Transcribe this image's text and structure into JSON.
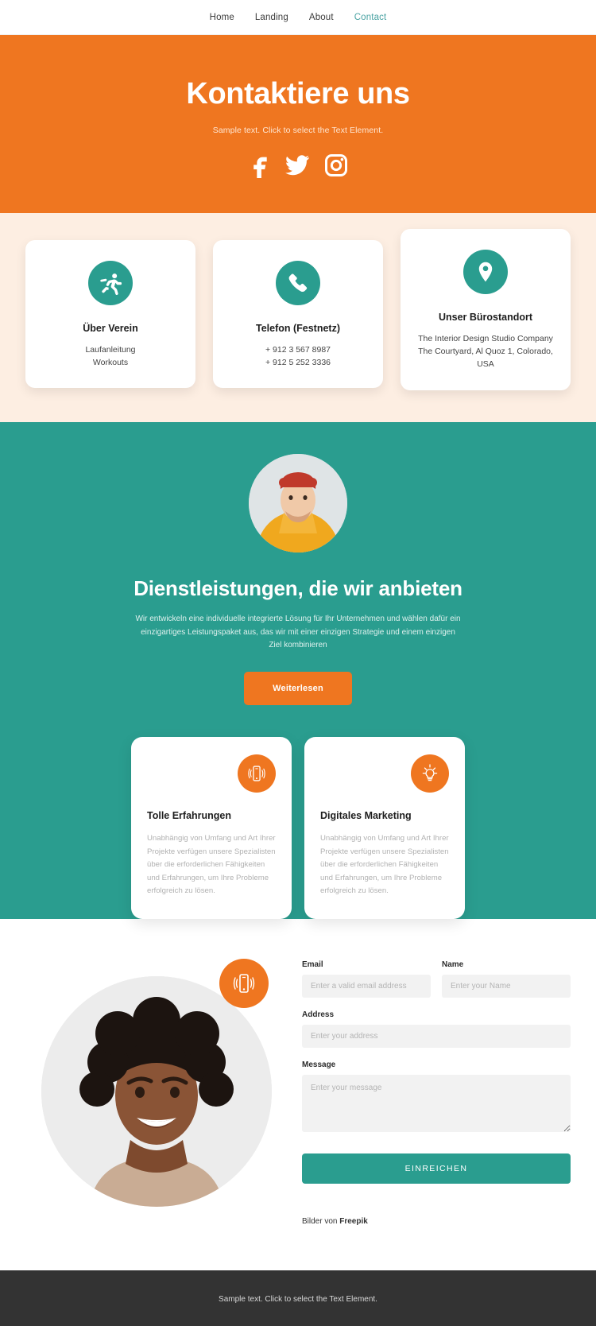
{
  "nav": {
    "items": [
      {
        "label": "Home",
        "active": false
      },
      {
        "label": "Landing",
        "active": false
      },
      {
        "label": "About",
        "active": false
      },
      {
        "label": "Contact",
        "active": true
      }
    ]
  },
  "hero": {
    "title": "Kontaktiere uns",
    "subtitle": "Sample text. Click to select the Text Element.",
    "background_color": "#ef7620",
    "socials": [
      {
        "name": "facebook-icon"
      },
      {
        "name": "twitter-icon"
      },
      {
        "name": "instagram-icon"
      }
    ]
  },
  "contact_cards": {
    "background_color": "#fdeee2",
    "icon_color": "#2a9d8f",
    "items": [
      {
        "icon": "running-person-icon",
        "title": "Über Verein",
        "lines": [
          "Laufanleitung",
          "Workouts"
        ]
      },
      {
        "icon": "phone-icon",
        "title": "Telefon (Festnetz)",
        "lines": [
          "+ 912 3 567 8987",
          "+ 912 5 252 3336"
        ]
      },
      {
        "icon": "map-pin-icon",
        "title": "Unser Bürostandort",
        "lines": [
          "The Interior Design Studio Company",
          "The Courtyard, Al Quoz 1, Colorado,",
          "USA"
        ]
      }
    ]
  },
  "services": {
    "background_color": "#2a9d8f",
    "avatar_alt": "man-with-red-beanie-photo",
    "title": "Dienstleistungen, die wir anbieten",
    "body": "Wir entwickeln eine individuelle integrierte Lösung für Ihr Unternehmen und wählen dafür ein einzigartiges Leistungspaket aus, das wir mit einer einzigen Strategie und einem einzigen Ziel kombinieren",
    "cta_label": "Weiterlesen",
    "cta_color": "#ef7620",
    "features": [
      {
        "icon": "vibrating-phone-icon",
        "title": "Tolle Erfahrungen",
        "body": "Unabhängig von Umfang und Art Ihrer Projekte verfügen unsere Spezialisten über die erforderlichen Fähigkeiten und Erfahrungen, um Ihre Probleme erfolgreich zu lösen."
      },
      {
        "icon": "lightbulb-icon",
        "title": "Digitales Marketing",
        "body": "Unabhängig von Umfang und Art Ihrer Projekte verfügen unsere Spezialisten über die erforderlichen Fähigkeiten und Erfahrungen, um Ihre Probleme erfolgreich zu lösen."
      }
    ]
  },
  "contact_form": {
    "photo_alt": "smiling-woman-curly-hair-photo",
    "photo_badge_icon": "vibrating-phone-icon",
    "fields": {
      "email": {
        "label": "Email",
        "value": "",
        "placeholder": "Enter a valid email address"
      },
      "name": {
        "label": "Name",
        "value": "",
        "placeholder": "Enter your Name"
      },
      "address": {
        "label": "Address",
        "value": "",
        "placeholder": "Enter your address"
      },
      "message": {
        "label": "Message",
        "value": "",
        "placeholder": "Enter your message"
      }
    },
    "submit_label": "EINREICHEN",
    "submit_color": "#2a9d8f",
    "credit_prefix": "Bilder von ",
    "credit_source": "Freepik"
  },
  "footer": {
    "background_color": "#333333",
    "text": "Sample text. Click to select the Text Element."
  }
}
